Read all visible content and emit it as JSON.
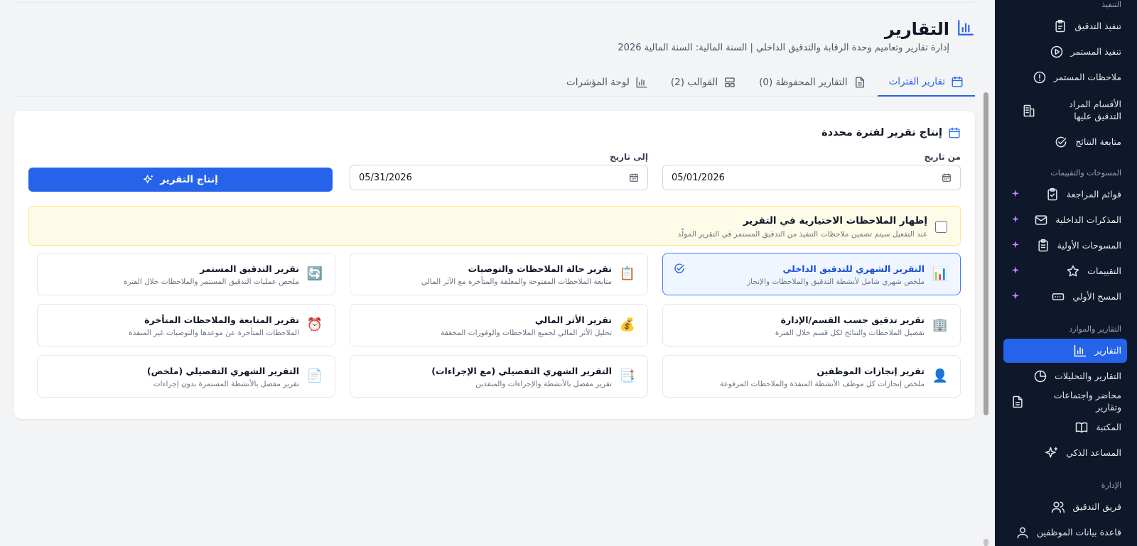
{
  "sidebar": {
    "sections": [
      {
        "label": "التنفيذ"
      },
      {
        "label": "المسوحات والتقييمات"
      },
      {
        "label": "التقارير والموارد"
      },
      {
        "label": "الإدارة"
      }
    ],
    "items": [
      {
        "label": "تنفيذ التدقيق",
        "icon": "clipboard-icon"
      },
      {
        "label": "تنفيذ المستمر",
        "icon": "play-circle-icon"
      },
      {
        "label": "ملاحظات المستمر",
        "icon": "alert-circle-icon"
      },
      {
        "label": "الأقسام المراد التدقيق عليها",
        "icon": "building-icon"
      },
      {
        "label": "متابعة النتائج",
        "icon": "check-circle-icon"
      },
      {
        "label": "قوائم المراجعة",
        "icon": "clipboard-check-icon"
      },
      {
        "label": "المذكرات الداخلية",
        "icon": "mail-icon"
      },
      {
        "label": "المسوحات الأولية",
        "icon": "clipboard-list-icon"
      },
      {
        "label": "التقييمات",
        "icon": "star-icon"
      },
      {
        "label": "المسح الأولي",
        "icon": "scan-icon"
      },
      {
        "label": "التقارير",
        "icon": "bar-chart-icon"
      },
      {
        "label": "التقارير والتحليلات",
        "icon": "pie-chart-icon"
      },
      {
        "label": "محاضر واجتماعات وتقارير",
        "icon": "file-text-icon"
      },
      {
        "label": "المكتبة",
        "icon": "book-icon"
      },
      {
        "label": "المساعد الذكي",
        "icon": "sparkles-icon"
      },
      {
        "label": "فريق التدقيق",
        "icon": "users-icon"
      },
      {
        "label": "قاعدة بيانات الموظفين",
        "icon": "user-icon"
      }
    ],
    "active_item": "التقارير",
    "accent": "#2563eb",
    "background": "#0f172a"
  },
  "header": {
    "title": "التقارير",
    "subtitle": "إدارة تقارير وتعاميم وحدة الرقابة والتدقيق الداخلي | السنة المالية: السنة المالية 2026"
  },
  "tabs": [
    {
      "label": "تقارير الفترات",
      "icon": "calendar-icon",
      "active": true
    },
    {
      "label": "التقارير المحفوظة (0)",
      "icon": "file-icon",
      "active": false
    },
    {
      "label": "القوالب (2)",
      "icon": "layout-icon",
      "active": false
    },
    {
      "label": "لوحة المؤشرات",
      "icon": "bar-chart-icon",
      "active": false
    }
  ],
  "period_form": {
    "title": "إنتاج تقرير لفترة محددة",
    "from_label": "من تاريخ",
    "from_value": "05/01/2026",
    "to_label": "إلى تاريخ",
    "to_value": "05/31/2026",
    "generate_label": "إنتاج التقرير"
  },
  "optional_notes": {
    "title": "إظهار الملاحظات الاختيارية في التقرير",
    "description": "عند التفعيل سيتم تضمين ملاحظات التنفيذ من التدقيق المستمر في التقرير المولّد",
    "checked": false
  },
  "report_types": [
    {
      "title": "التقرير الشهري للتدقيق الداخلي",
      "desc": "ملخص شهري شامل لأنشطة التدقيق والملاحظات والإنجاز",
      "emoji": "📊",
      "selected": true
    },
    {
      "title": "تقرير حالة الملاحظات والتوصيات",
      "desc": "متابعة الملاحظات المفتوحة والمغلقة والمتأخرة مع الأثر المالي",
      "emoji": "📋",
      "selected": false
    },
    {
      "title": "تقرير التدقيق المستمر",
      "desc": "ملخص عمليات التدقيق المستمر والملاحظات خلال الفترة",
      "emoji": "🔄",
      "selected": false
    },
    {
      "title": "تقرير تدقيق حسب القسم/الإدارة",
      "desc": "تفصيل الملاحظات والنتائج لكل قسم خلال الفترة",
      "emoji": "🏢",
      "selected": false
    },
    {
      "title": "تقرير الأثر المالي",
      "desc": "تحليل الأثر المالي لجميع الملاحظات والوفورات المحققة",
      "emoji": "💰",
      "selected": false
    },
    {
      "title": "تقرير المتابعة والملاحظات المتأخرة",
      "desc": "الملاحظات المتأخرة عن موعدها والتوصيات غير المنفذة",
      "emoji": "⏰",
      "selected": false
    },
    {
      "title": "تقرير إنجازات الموظفين",
      "desc": "ملخص إنجازات كل موظف الأنشطة المنفذة والملاحظات المرفوعة",
      "emoji": "👤",
      "selected": false
    },
    {
      "title": "التقرير الشهري التفصيلي (مع الإجراءات)",
      "desc": "تقرير مفصل بالأنشطة والإجراءات والمنفذين",
      "emoji": "📑",
      "selected": false
    },
    {
      "title": "التقرير الشهري التفصيلي (ملخص)",
      "desc": "تقرير مفصل بالأنشطة المستمرة بدون إجراءات",
      "emoji": "📄",
      "selected": false
    }
  ]
}
